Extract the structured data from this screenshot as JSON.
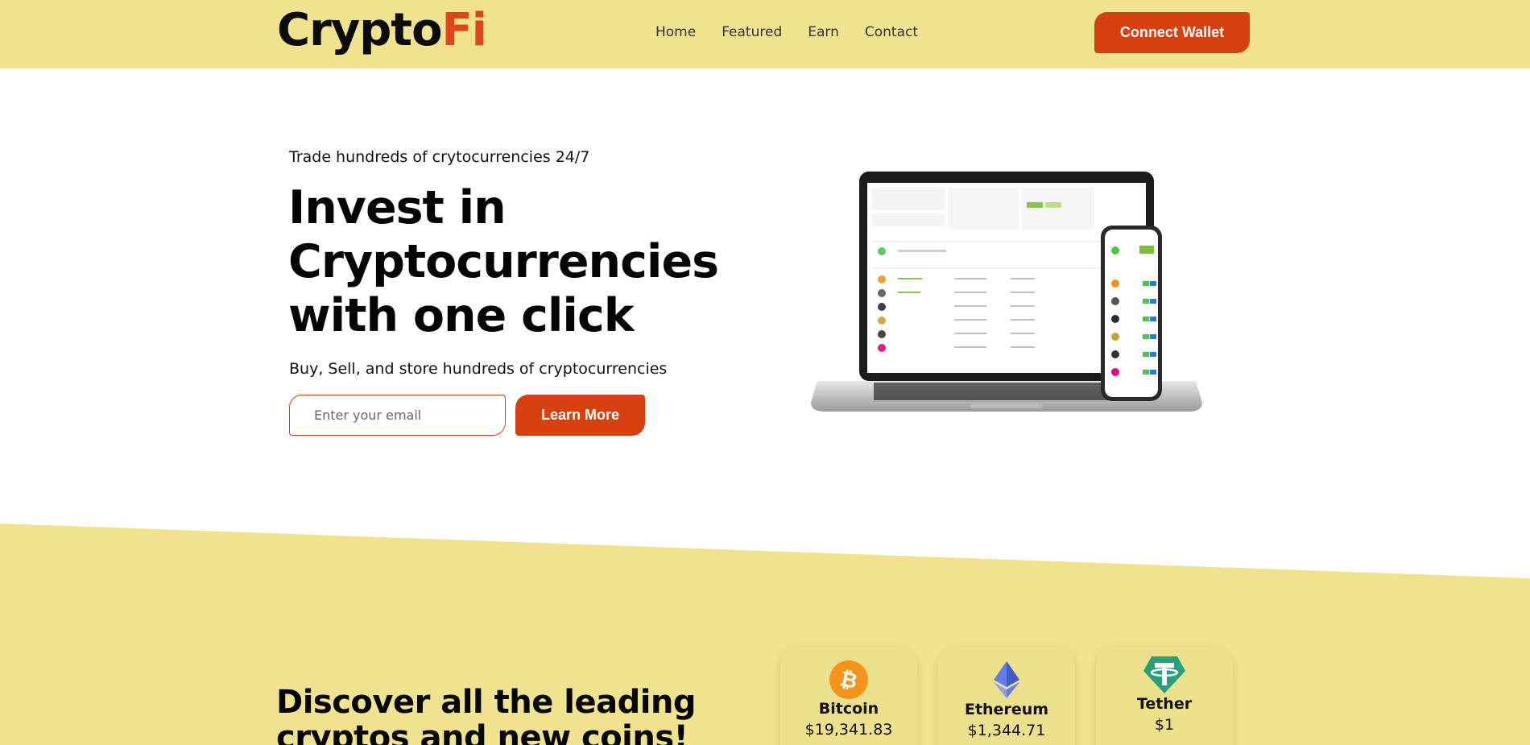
{
  "header": {
    "logo_main": "Crypto",
    "logo_accent": "Fi",
    "nav": [
      "Home",
      "Featured",
      "Earn",
      "Contact"
    ],
    "connect_label": "Connect Wallet"
  },
  "hero": {
    "tagline": "Trade hundreds of crytocurrencies 24/7",
    "title_line1": "Invest in",
    "title_line2": "Cryptocurrencies",
    "title_line3": "with one click",
    "subtitle": "Buy, Sell, and store hundreds of cryptocurrencies",
    "email_placeholder": "Enter your email",
    "learn_label": "Learn More"
  },
  "discover": {
    "title": "Discover all the leading cryptos and new coins!"
  },
  "coins": [
    {
      "name": "Bitcoin",
      "price": "$19,341.83",
      "icon": "bitcoin-icon",
      "color": "#f7931a"
    },
    {
      "name": "Ethereum",
      "price": "$1,344.71",
      "icon": "ethereum-icon",
      "color": "#627eea"
    },
    {
      "name": "Tether",
      "price": "$1",
      "icon": "tether-icon",
      "color": "#26a17b"
    }
  ],
  "colors": {
    "brand_yellow": "#f0e28e",
    "accent_red": "#d9400f"
  }
}
